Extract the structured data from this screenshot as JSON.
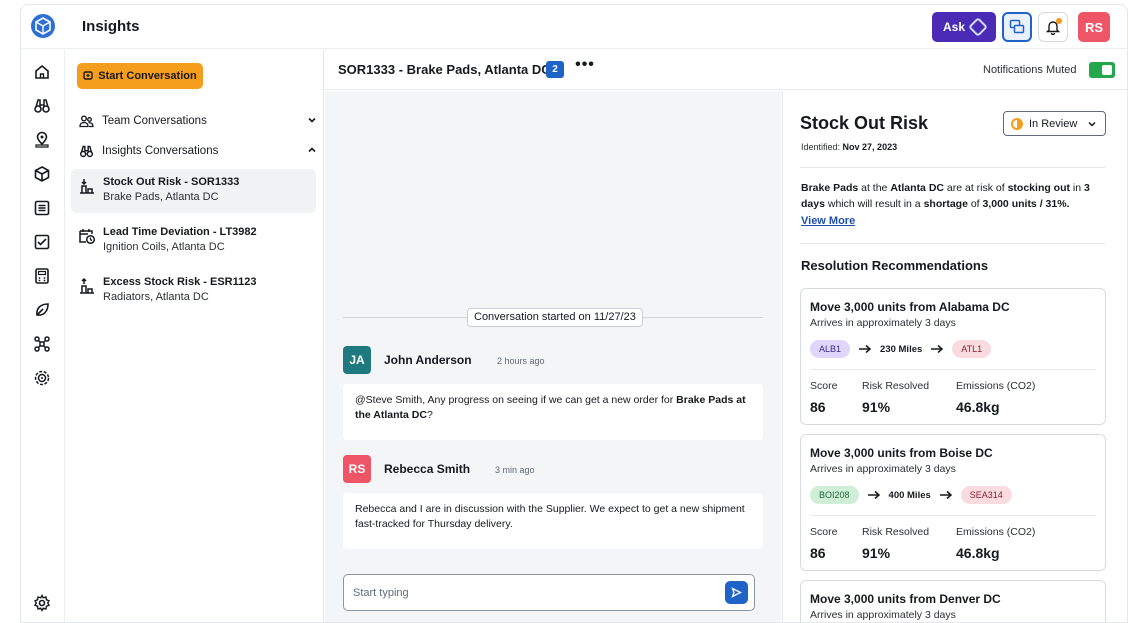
{
  "app": {
    "title": "Insights",
    "ask_label": "Ask",
    "user_initials": "RS"
  },
  "colors": {
    "brand_purple": "#4b2bb5",
    "primary_blue": "#1f63c6",
    "start_orange": "#f59d1c",
    "avatar_red": "#ee5566",
    "avatar_teal": "#1e7a7f",
    "toggle_green": "#22a84a"
  },
  "rail": {
    "icons": [
      "home-icon",
      "binoculars-icon",
      "location-icon",
      "package-icon",
      "list-icon",
      "checklist-icon",
      "calculator-icon",
      "leaf-icon",
      "network-icon",
      "target-icon",
      "settings-icon"
    ]
  },
  "sidebar": {
    "start_label": "Start Conversation",
    "groups": [
      {
        "label": "Team Conversations",
        "icon": "team-icon",
        "expanded": false
      },
      {
        "label": "Insights Conversations",
        "icon": "binoculars-icon",
        "expanded": true
      }
    ],
    "conversations": [
      {
        "title": "Stock Out Risk - SOR1333",
        "subtitle": "Brake Pads, Atlanta DC",
        "icon": "stock-out-icon",
        "active": true
      },
      {
        "title": "Lead Time Deviation - LT3982",
        "subtitle": "Ignition Coils, Atlanta DC",
        "icon": "clock-calendar-icon",
        "active": false
      },
      {
        "title": "Excess Stock Risk - ESR1123",
        "subtitle": "Radiators, Atlanta DC",
        "icon": "excess-stock-icon",
        "active": false
      }
    ]
  },
  "conversation": {
    "title": "SOR1333 - Brake Pads, Atlanta DC",
    "participant_count": "2",
    "more_label": "•••",
    "notifications_label": "Notifications Muted",
    "notifications_muted": true,
    "started_label": "Conversation started on 11/27/23",
    "messages": [
      {
        "initials": "JA",
        "author": "John Anderson",
        "time": "2 hours ago",
        "text_before": "@Steve Smith, Any progress on seeing if we can get a new order for ",
        "text_bold": "Brake Pads at the Atlanta DC",
        "text_after": "?"
      },
      {
        "initials": "RS",
        "author": "Rebecca Smith",
        "time": "3 min ago",
        "text": "Rebecca and I are in discussion with the Supplier. We expect to get a new shipment fast-tracked for Thursday delivery."
      }
    ],
    "composer_placeholder": "Start typing"
  },
  "risk": {
    "title": "Stock Out Risk",
    "identified_label": "Identified:",
    "identified_date": "Nov 27, 2023",
    "status": "In Review",
    "summary": {
      "p1": "Brake Pads",
      "p2": " at the ",
      "p3": "Atlanta DC",
      "p4": " are at risk of ",
      "p5": "stocking out",
      "p6": " in ",
      "p7": "3 days",
      "p8": " which will result in a ",
      "p9": "shortage",
      "p10": " of ",
      "p11": "3,000 units / 31%."
    },
    "view_more": "View More",
    "recommendations_heading": "Resolution Recommendations",
    "metric_labels": {
      "score": "Score",
      "risk_resolved": "Risk Resolved",
      "emissions": "Emissions (CO2)"
    },
    "recommendations": [
      {
        "title": "Move 3,000 units from Alabama DC",
        "subtitle": "Arrives in approximately 3 days",
        "from": "ALB1",
        "distance": "230 Miles",
        "to": "ATL1",
        "score": "86",
        "risk_resolved": "91%",
        "emissions": "46.8kg"
      },
      {
        "title": "Move 3,000 units from Boise DC",
        "subtitle": "Arrives in approximately 3 days",
        "from": "BOI208",
        "distance": "400 Miles",
        "to": "SEA314",
        "score": "86",
        "risk_resolved": "91%",
        "emissions": "46.8kg"
      },
      {
        "title": "Move 3,000 units from Denver DC",
        "subtitle": "Arrives in approximately 3 days"
      }
    ]
  }
}
